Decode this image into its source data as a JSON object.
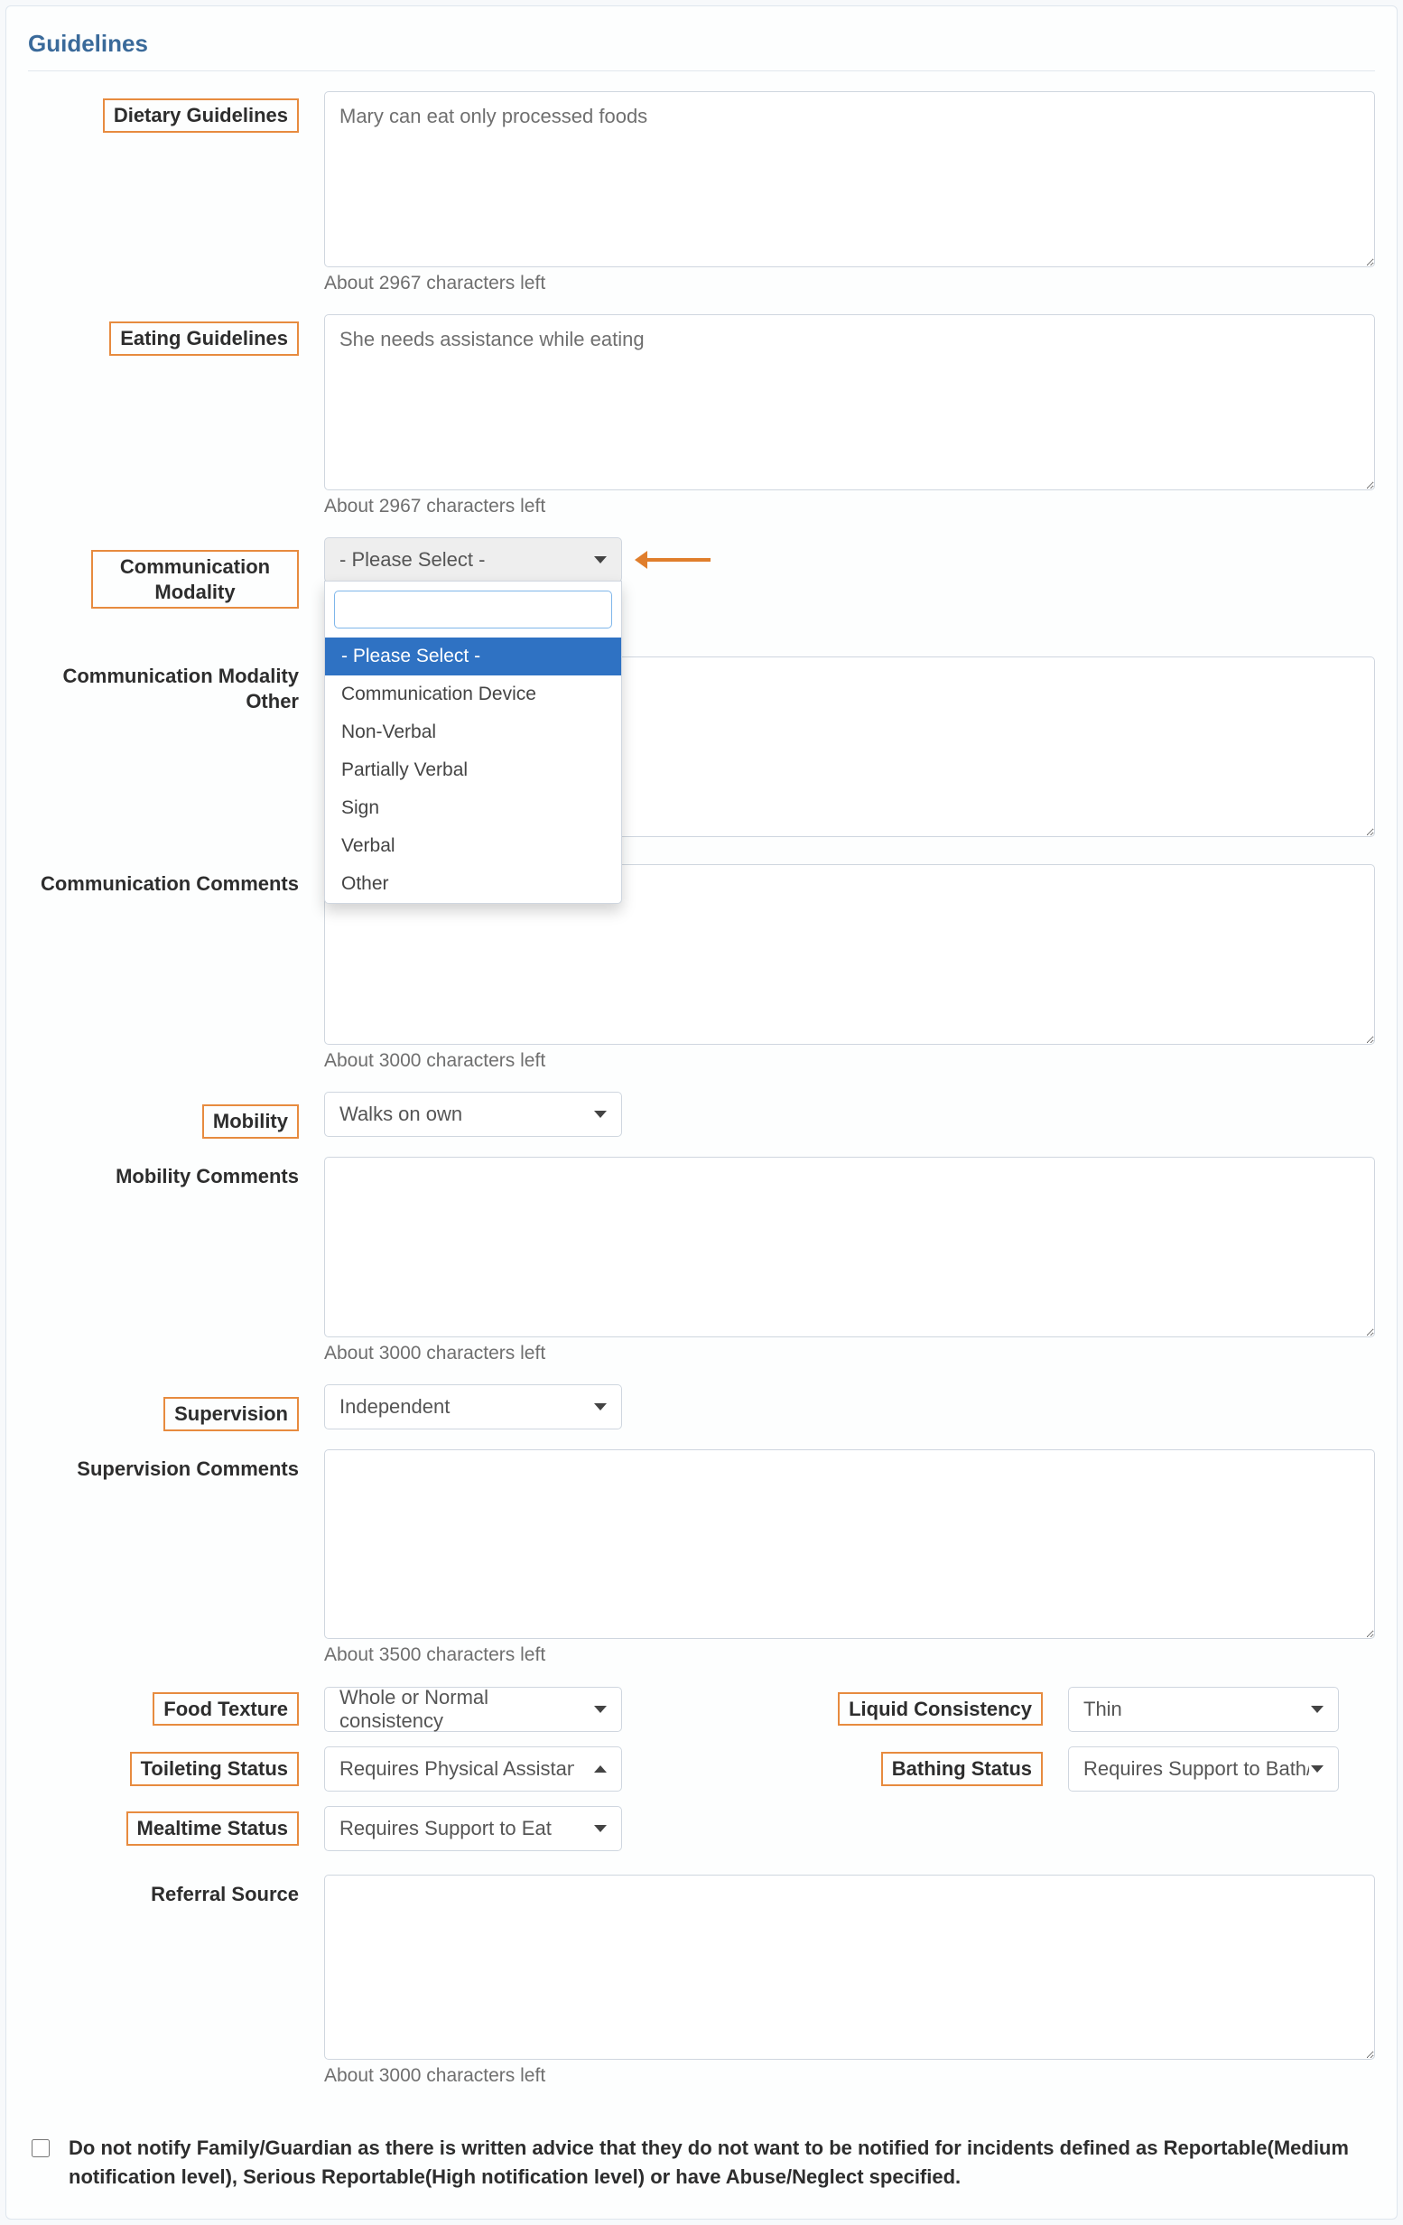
{
  "section_title": "Guidelines",
  "labels": {
    "dietary": "Dietary Guidelines",
    "eating": "Eating Guidelines",
    "comm_modality": "Communication Modality",
    "comm_modality_other": "Communication Modality Other",
    "comm_comments": "Communication Comments",
    "mobility": "Mobility",
    "mobility_comments": "Mobility Comments",
    "supervision": "Supervision",
    "supervision_comments": "Supervision Comments",
    "food_texture": "Food Texture",
    "liquid_consistency": "Liquid Consistency",
    "toileting_status": "Toileting Status",
    "bathing_status": "Bathing Status",
    "mealtime_status": "Mealtime Status",
    "referral_source": "Referral Source"
  },
  "values": {
    "dietary": "Mary can eat only processed foods",
    "eating": "She needs assistance while eating",
    "comm_modality_other": "",
    "comm_comments": "",
    "mobility_comments": "",
    "supervision_comments": "",
    "referral_source": ""
  },
  "counts": {
    "dietary": "About 2967 characters left",
    "eating": "About 2967 characters left",
    "comm_comments": "About 3000 characters left",
    "mobility_comments": "About 3000 characters left",
    "supervision_comments": "About 3500 characters left",
    "referral_source": "About 3000 characters left"
  },
  "selects": {
    "comm_modality": "- Please Select -",
    "mobility": "Walks on own",
    "supervision": "Independent",
    "food_texture": "Whole or Normal consistency",
    "liquid_consistency": "Thin",
    "toileting_status": "Requires Physical Assistance/Equi",
    "bathing_status": "Requires Support to Bath/Shower",
    "mealtime_status": "Requires Support to Eat"
  },
  "comm_modality_options": [
    "- Please Select -",
    "Communication Device",
    "Non-Verbal",
    "Partially Verbal",
    "Sign",
    "Verbal",
    "Other"
  ],
  "checkbox_label": "Do not notify Family/Guardian as there is written advice that they do not want to be notified for incidents defined as Reportable(Medium notification level), Serious Reportable(High notification level) or have Abuse/Neglect specified."
}
